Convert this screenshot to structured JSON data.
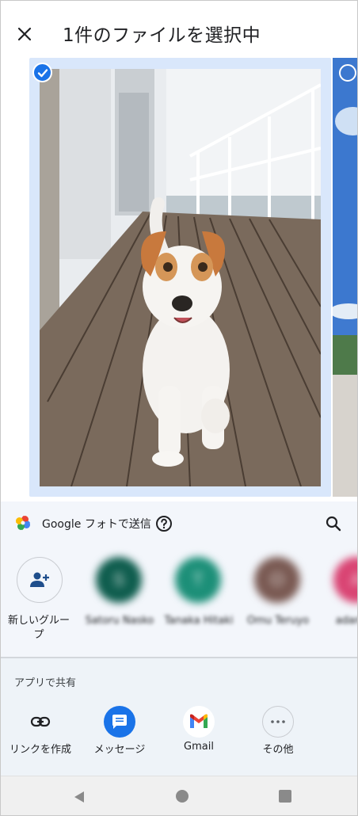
{
  "header": {
    "title": "1件のファイルを選択中",
    "close_icon": "close-icon"
  },
  "photos": [
    {
      "selected": true,
      "subject": "dog-on-wooden-deck"
    },
    {
      "selected": false,
      "subject": "blue-sky-landscape"
    }
  ],
  "share_target": {
    "label": "Google フォトで送信"
  },
  "contacts": {
    "new_group_label": "新しいグループ",
    "people": [
      {
        "name": "Satoru Nasko",
        "initial": "S",
        "color": "#0f5d4e"
      },
      {
        "name": "Tanaka Hitaki",
        "initial": "T",
        "color": "#1c8f78"
      },
      {
        "name": "Omu Teruyo",
        "initial": "O",
        "color": "#7a5a53"
      },
      {
        "name": "adamHe",
        "initial": "A",
        "color": "#d94473"
      }
    ]
  },
  "apps_section": {
    "heading": "アプリで共有",
    "apps": [
      {
        "label": "リンクを作成",
        "icon": "link-icon"
      },
      {
        "label": "メッセージ",
        "icon": "messages-icon",
        "color": "#1a73e8"
      },
      {
        "label": "Gmail",
        "icon": "gmail-icon"
      },
      {
        "label": "その他",
        "icon": "more-icon"
      }
    ]
  },
  "colors": {
    "accent": "#1a73e8",
    "sheet_bg": "#eef3f8",
    "selected_frame": "#d9e7fb"
  }
}
